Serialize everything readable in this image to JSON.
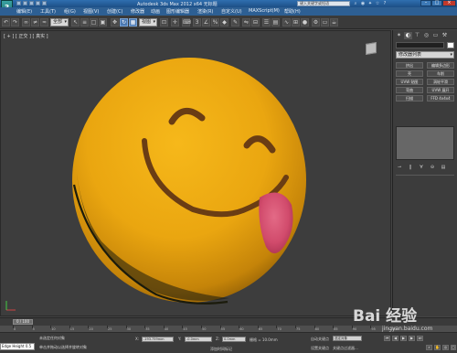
{
  "title_bar": {
    "app_icon": "3",
    "title": "Autodesk 3ds Max  2012 x64   无标题",
    "search_placeholder": "键入关键字或短语"
  },
  "menu": {
    "items": [
      "编辑(E)",
      "工具(T)",
      "组(G)",
      "视图(V)",
      "创建(C)",
      "修改器",
      "动画",
      "图形编辑器",
      "渲染(R)",
      "自定义(U)",
      "MAXScript(M)",
      "帮助(H)"
    ]
  },
  "toolbar": {
    "selection_filter": "全部",
    "reference_coord": "视图"
  },
  "viewport": {
    "label": "[ + ] [ 正交 ] [ 真实 ]"
  },
  "command_panel": {
    "modifier_list": "修改器列表",
    "buttons": [
      "挤出",
      "编辑多边形",
      "壳",
      "车削",
      "UVW 贴图",
      "涡轮平滑",
      "弯曲",
      "UVW 展开",
      "扫描",
      "FFD 4x4x4"
    ]
  },
  "timeline": {
    "frame_display": "0 / 100",
    "ticks": [
      "0",
      "5",
      "10",
      "15",
      "20",
      "25",
      "30",
      "35",
      "40",
      "45",
      "50",
      "55",
      "60",
      "65",
      "70",
      "75",
      "80",
      "85",
      "90",
      "95",
      "100"
    ]
  },
  "status_bar": {
    "maxscript": "Edge Height 0.5",
    "status_top": "未选定任何对象",
    "status_bottom": "单击并拖动以选择并旋转对象",
    "x_label": "X:",
    "x_value": "-193.759mm",
    "y_label": "Y:",
    "y_value": "-0.0mm",
    "z_label": "Z:",
    "z_value": "0.0mm",
    "grid_label": "栅格 = 10.0mm",
    "auto_key": "自动关键点",
    "set_key": "设置关键点",
    "selected": "选定对象",
    "key_filters": "关键点过滤器...",
    "add_time_tag": "添加时间标记"
  },
  "watermark": {
    "text": "Bai 经验",
    "url": "jingyan.baidu.com"
  }
}
